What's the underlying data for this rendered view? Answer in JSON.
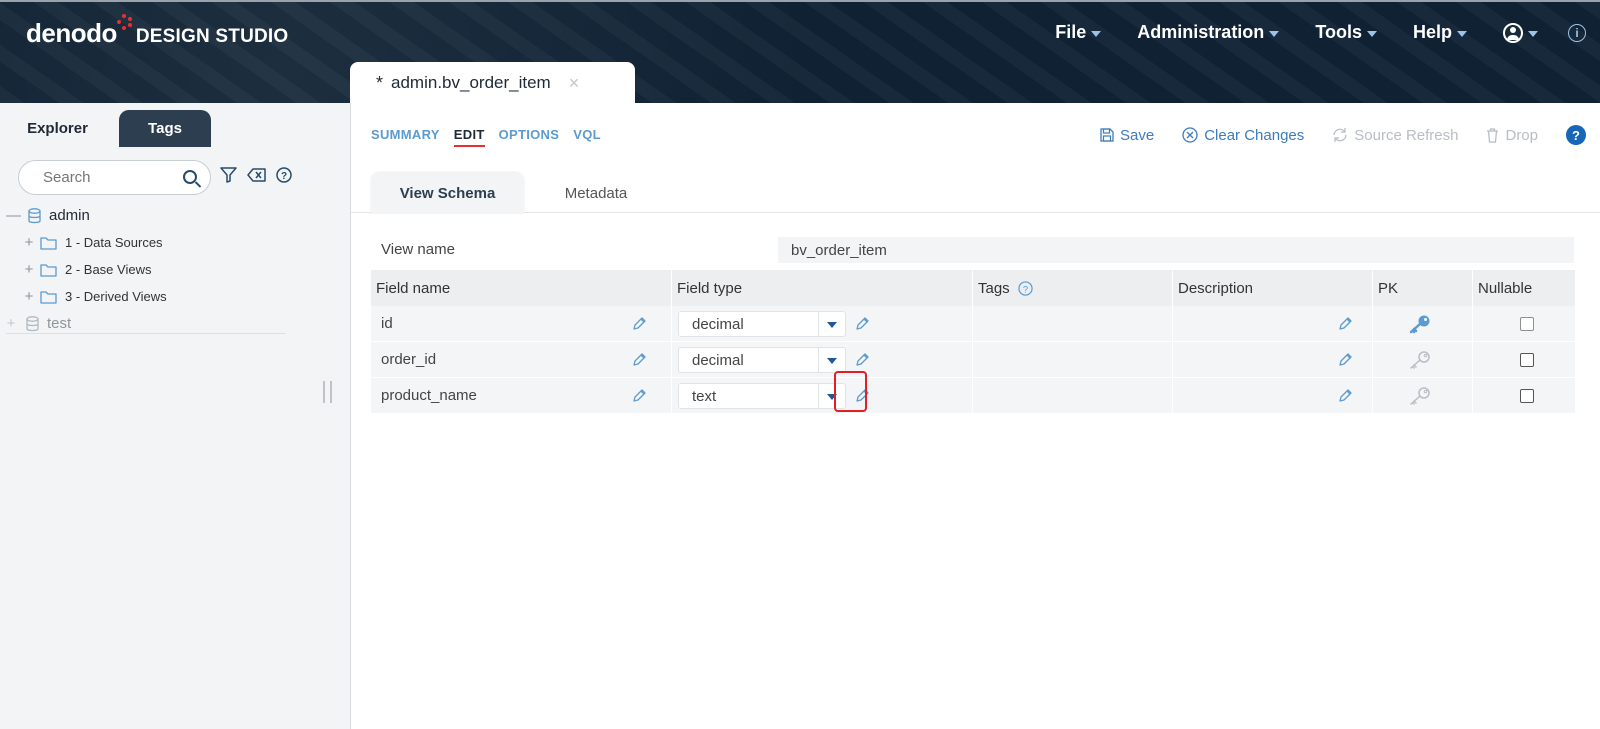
{
  "header": {
    "logo_main": "denodo",
    "logo_sub": "DESIGN STUDIO",
    "menu": [
      {
        "label": "File"
      },
      {
        "label": "Administration"
      },
      {
        "label": "Tools"
      },
      {
        "label": "Help"
      }
    ],
    "info_glyph": "i"
  },
  "sidebar": {
    "tabs": [
      {
        "label": "Explorer",
        "active": true
      },
      {
        "label": "Tags",
        "active": false
      }
    ],
    "search_placeholder": "Search",
    "tree": [
      {
        "label": "admin",
        "type": "database",
        "expanded": true
      },
      {
        "label": "1 - Data Sources",
        "type": "folder"
      },
      {
        "label": "2 - Base Views",
        "type": "folder"
      },
      {
        "label": "3 - Derived Views",
        "type": "folder"
      },
      {
        "label": "test",
        "type": "database",
        "expanded": false
      }
    ]
  },
  "document_tab": {
    "modified_marker": "*",
    "title": "admin.bv_order_item",
    "close_glyph": "×"
  },
  "subnav": [
    {
      "label": "SUMMARY",
      "active": false
    },
    {
      "label": "EDIT",
      "active": true
    },
    {
      "label": "OPTIONS",
      "active": false
    },
    {
      "label": "VQL",
      "active": false
    }
  ],
  "actions": {
    "save": "Save",
    "clear": "Clear Changes",
    "refresh": "Source Refresh",
    "drop": "Drop",
    "help_glyph": "?"
  },
  "inner_tabs": [
    {
      "label": "View Schema",
      "active": true
    },
    {
      "label": "Metadata",
      "active": false
    }
  ],
  "view_name": {
    "label": "View name",
    "value": "bv_order_item"
  },
  "grid": {
    "columns": [
      "Field name",
      "Field type",
      "Tags",
      "Description",
      "PK",
      "Nullable"
    ],
    "rows": [
      {
        "name": "id",
        "type": "decimal",
        "pk": true,
        "nullable": false
      },
      {
        "name": "order_id",
        "type": "decimal",
        "pk": false,
        "nullable": false
      },
      {
        "name": "product_name",
        "type": "text",
        "pk": false,
        "nullable": false
      }
    ]
  },
  "colors": {
    "header_bg": "#0f2133",
    "accent": "#e8302f",
    "link_blue": "#3b7bbf",
    "icon_blue": "#5b9bd0"
  }
}
